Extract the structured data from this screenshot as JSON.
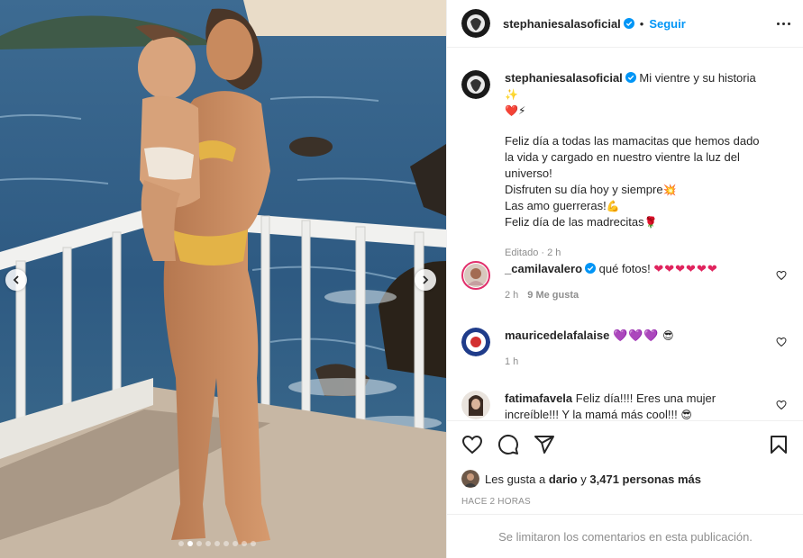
{
  "post": {
    "username": "stephaniesalasoficial",
    "follow_label": "Seguir",
    "separator": "•"
  },
  "caption": {
    "username": "stephaniesalasoficial",
    "title": "Mi vientre y su historia",
    "title_emoji": "✨",
    "title_emoji2": "❤️⚡",
    "line1": "Feliz día a todas las mamacitas que hemos dado la vida y cargado en nuestro vientre la luz del universo!",
    "line2": "Disfruten su día hoy y siempre",
    "line2_emoji": "💥",
    "line3": "Las amo guerreras!",
    "line3_emoji": "💪",
    "line4": "Feliz día de las madrecitas",
    "line4_emoji": "🌹",
    "meta": "Editado · 2 h"
  },
  "comments": [
    {
      "username": "_camilavalero",
      "verified": true,
      "text": "qué fotos!",
      "emoji": "❤❤❤❤❤❤",
      "time": "2 h",
      "likes": "9 Me gusta"
    },
    {
      "username": "mauricedelafalaise",
      "verified": false,
      "text": "",
      "emoji": "💜💜💜",
      "emoji2": "😎",
      "time": "1 h",
      "likes": ""
    },
    {
      "username": "fatimafavela",
      "verified": false,
      "text": "Feliz día!!!! Eres una mujer increíble!!! Y la mamá más cool!!!",
      "emoji": "😎",
      "time": "",
      "likes": ""
    }
  ],
  "likes": {
    "prefix": "Les gusta a",
    "user": "dario",
    "connector": "y",
    "count": "3,471 personas más"
  },
  "timestamp": "HACE 2 HORAS",
  "comments_limited": "Se limitaron los comentarios en esta publicación.",
  "carousel": {
    "total": 9,
    "active": 1
  },
  "icons": [
    "heart-icon",
    "comment-icon",
    "share-icon",
    "bookmark-icon",
    "more-icon",
    "verified-icon",
    "chevron-left-icon",
    "chevron-right-icon"
  ],
  "colors": {
    "accent": "#0095f6",
    "text": "#262626",
    "muted": "#8e8e8e",
    "border": "#efefef"
  }
}
